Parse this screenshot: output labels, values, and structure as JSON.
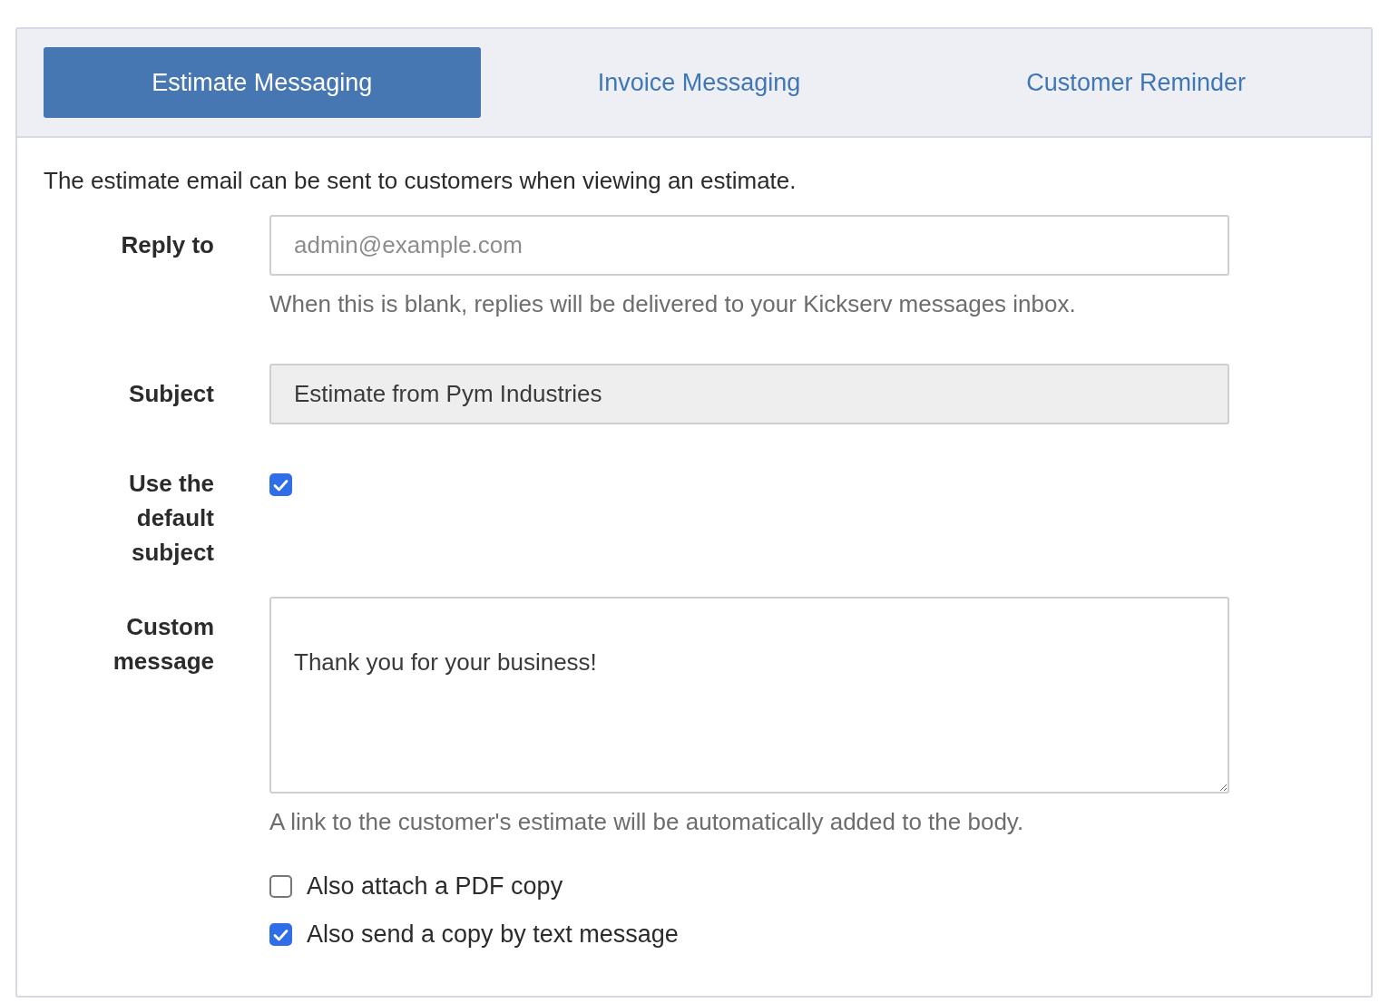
{
  "tabs": [
    {
      "label": "Estimate Messaging",
      "selected": true
    },
    {
      "label": "Invoice Messaging",
      "selected": false
    },
    {
      "label": "Customer Reminder",
      "selected": false
    }
  ],
  "intro": "The estimate email can be sent to customers when viewing an estimate.",
  "fields": [
    {
      "kind": "text",
      "label": "Reply to",
      "placeholder": "admin@example.com",
      "help": "When this is blank, replies will be delivered to your Kickserv messages inbox.",
      "disabled": false
    },
    {
      "kind": "text",
      "label": "Subject",
      "value": "Estimate from Pym Industries",
      "disabled": true
    },
    {
      "kind": "checkbox",
      "label": "Use the default subject",
      "checked": true
    },
    {
      "kind": "textarea",
      "label": "Custom message",
      "value": "Thank you for your business!",
      "help": "A link to the customer's estimate will be automatically added to the body."
    }
  ],
  "options": [
    {
      "label": "Also attach a PDF copy",
      "checked": false
    },
    {
      "label": "Also send a copy by text message",
      "checked": true
    }
  ]
}
